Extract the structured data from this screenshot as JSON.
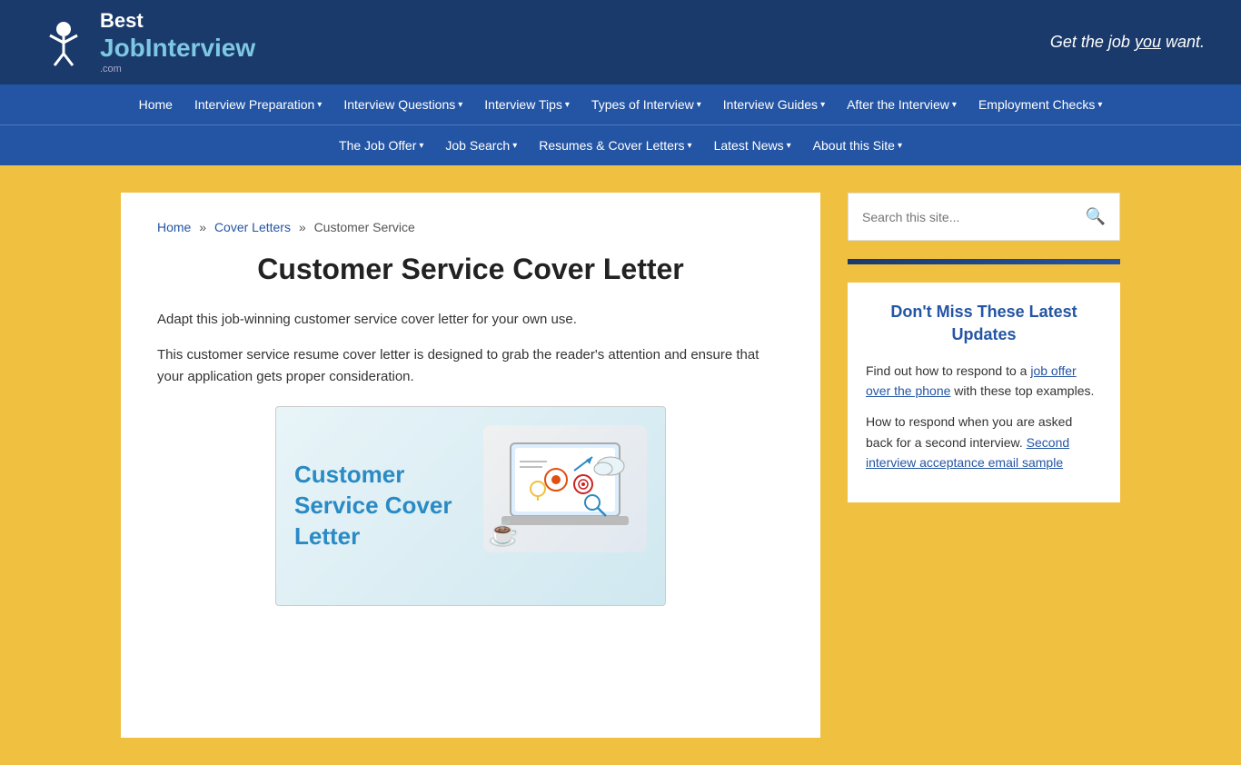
{
  "header": {
    "logo_best": "Best",
    "logo_job": "Job",
    "logo_interview": "Interview",
    "logo_dot_com": ".com",
    "tagline": "Get the job ",
    "tagline_underline": "you",
    "tagline_end": " want."
  },
  "nav": {
    "row1": [
      {
        "label": "Home",
        "has_dropdown": false
      },
      {
        "label": "Interview Preparation",
        "has_dropdown": true
      },
      {
        "label": "Interview Questions",
        "has_dropdown": true
      },
      {
        "label": "Interview Tips",
        "has_dropdown": true
      },
      {
        "label": "Types of Interview",
        "has_dropdown": true
      },
      {
        "label": "Interview Guides",
        "has_dropdown": true
      },
      {
        "label": "After the Interview",
        "has_dropdown": true
      },
      {
        "label": "Employment Checks",
        "has_dropdown": true
      }
    ],
    "row2": [
      {
        "label": "The Job Offer",
        "has_dropdown": true
      },
      {
        "label": "Job Search",
        "has_dropdown": true
      },
      {
        "label": "Resumes & Cover Letters",
        "has_dropdown": true
      },
      {
        "label": "Latest News",
        "has_dropdown": true
      },
      {
        "label": "About this Site",
        "has_dropdown": true
      }
    ]
  },
  "breadcrumb": {
    "home": "Home",
    "cover_letters": "Cover Letters",
    "current": "Customer Service",
    "sep": "»"
  },
  "main": {
    "page_title": "Customer Service Cover Letter",
    "para1": "Adapt this job-winning customer service cover letter for your own use.",
    "para2": "This customer service resume cover letter is designed to grab the reader's attention and ensure that your application gets proper consideration.",
    "image_title": "Customer Service Cover Letter"
  },
  "sidebar": {
    "search_placeholder": "Search this site...",
    "search_btn_label": "🔍",
    "widget_title": "Don't Miss These Latest Updates",
    "widget_text1_prefix": "Find out how to respond to a ",
    "widget_link1": "job offer over the phone",
    "widget_text1_suffix": " with these top examples.",
    "widget_text2_prefix": "How to respond when you are asked back for a second interview. ",
    "widget_link2": "Second interview acceptance email sample"
  },
  "colors": {
    "dark_blue": "#1a3a6b",
    "mid_blue": "#2455a4",
    "gold": "#f0c040",
    "link": "#2455a4"
  }
}
